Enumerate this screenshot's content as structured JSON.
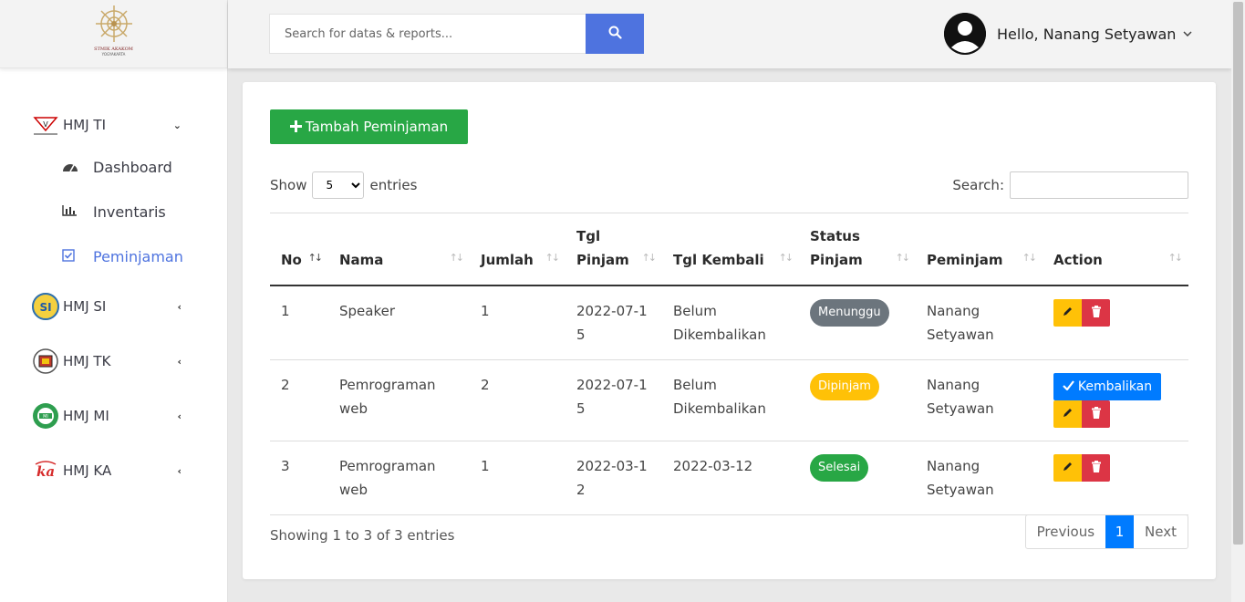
{
  "sidebar": {
    "logo_caption": "STMIK AKAKOM",
    "logo_sub": "YOGYAKARTA",
    "groups": [
      {
        "label": "HMJ TI",
        "chevron": "⌄"
      },
      {
        "label": "HMJ SI",
        "chevron": "‹"
      },
      {
        "label": "HMJ TK",
        "chevron": "‹"
      },
      {
        "label": "HMJ MI",
        "chevron": "‹"
      },
      {
        "label": "HMJ KA",
        "chevron": "‹"
      }
    ],
    "submenu": [
      {
        "label": "Dashboard",
        "icon": "tachometer-icon"
      },
      {
        "label": "Inventaris",
        "icon": "bar-chart-icon"
      },
      {
        "label": "Peminjaman",
        "icon": "checkbox-icon"
      }
    ],
    "active_item": "Peminjaman"
  },
  "topbar": {
    "search_placeholder": "Search for datas & reports...",
    "user_greeting": "Hello, Nanang Setyawan"
  },
  "main": {
    "add_button_label": "Tambah Peminjaman",
    "length": {
      "prefix": "Show",
      "value": "5",
      "suffix": "entries"
    },
    "search_label": "Search:",
    "columns": [
      "No",
      "Nama",
      "Jumlah",
      "Tgl Pinjam",
      "Tgl Kembali",
      "Status Pinjam",
      "Peminjam",
      "Action"
    ],
    "rows": [
      {
        "no": "1",
        "nama": "Speaker",
        "jumlah": "1",
        "tgl_pinjam": "2022-07-15",
        "tgl_kembali": "Belum Dikembalikan",
        "status": "Menunggu",
        "peminjam": "Nanang Setyawan"
      },
      {
        "no": "2",
        "nama": "Pemrograman web",
        "jumlah": "2",
        "tgl_pinjam": "2022-07-15",
        "tgl_kembali": "Belum Dikembalikan",
        "status": "Dipinjam",
        "peminjam": "Nanang Setyawan",
        "return_label": "Kembalikan"
      },
      {
        "no": "3",
        "nama": "Pemrograman web",
        "jumlah": "1",
        "tgl_pinjam": "2022-03-12",
        "tgl_kembali": "2022-03-12",
        "status": "Selesai",
        "peminjam": "Nanang Setyawan"
      }
    ],
    "info": "Showing 1 to 3 of 3 entries",
    "pagination": {
      "previous": "Previous",
      "current": "1",
      "next": "Next"
    }
  },
  "colors": {
    "primary": "#4e73df",
    "success": "#28a745",
    "warning": "#ffc107",
    "danger": "#dc3545",
    "secondary": "#6c757d",
    "info": "#007bff"
  }
}
